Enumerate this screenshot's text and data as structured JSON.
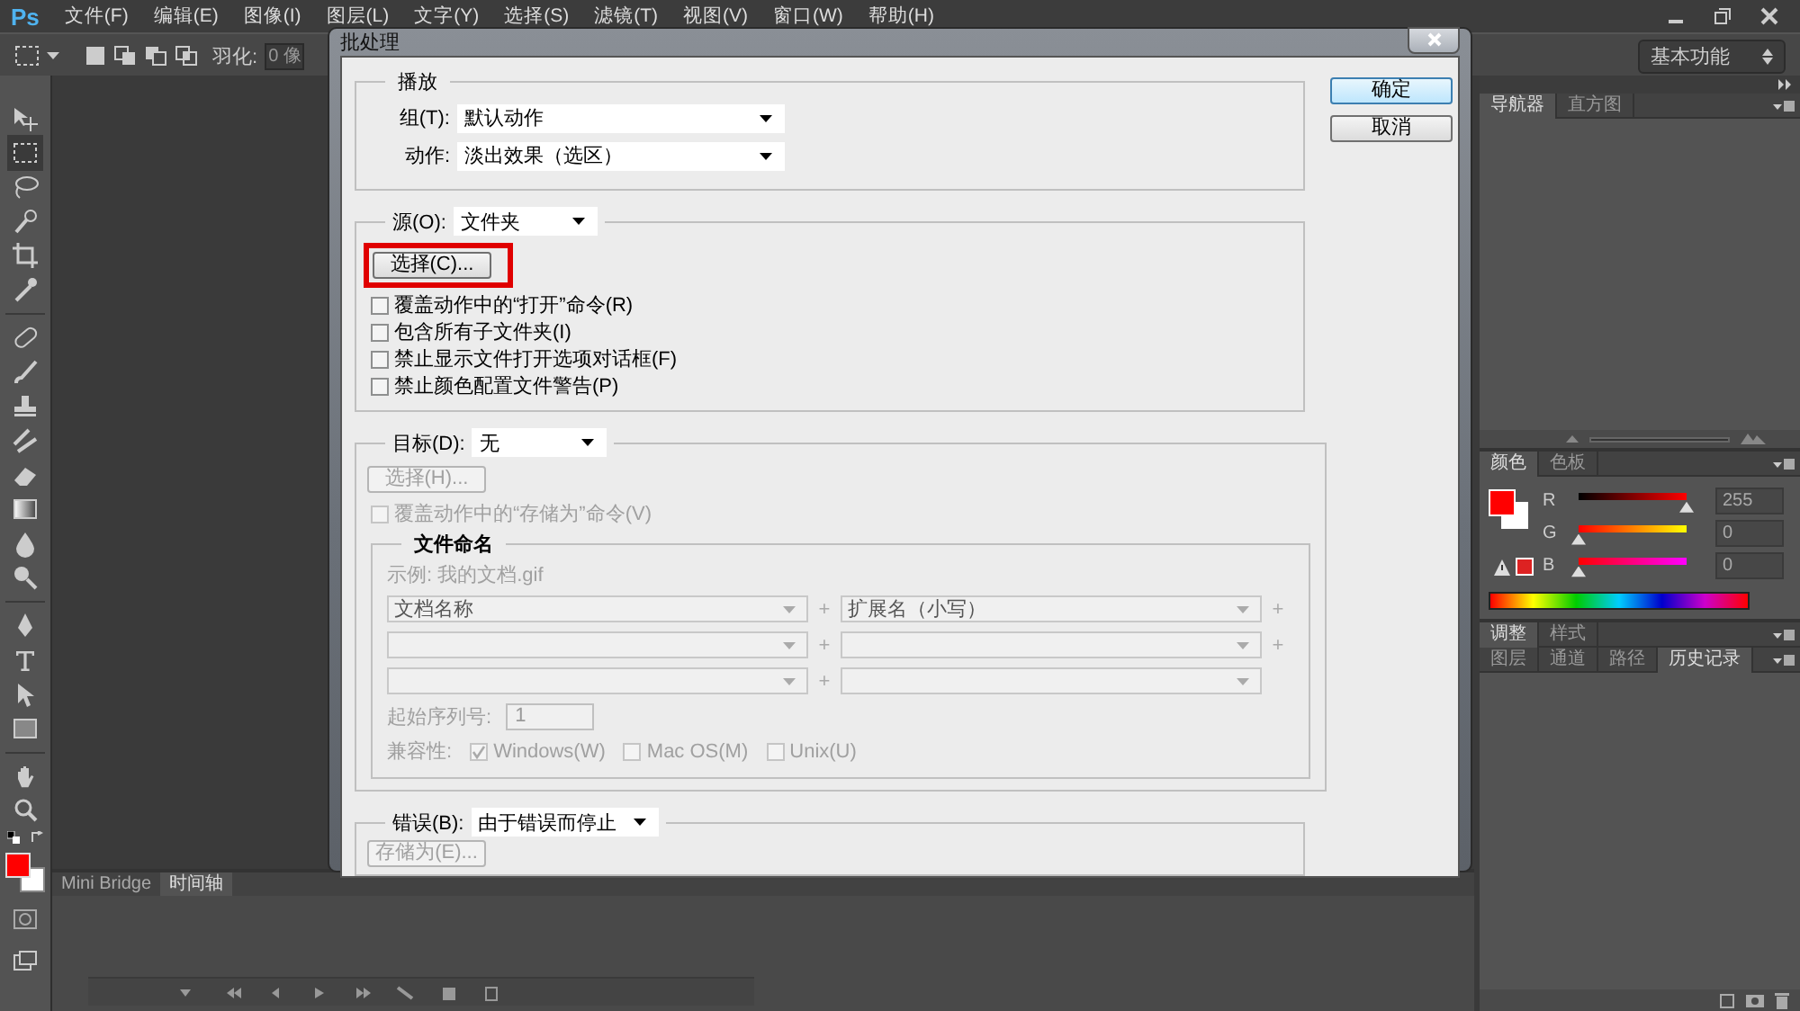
{
  "menu_bar": {
    "logo": "Ps",
    "items": [
      "文件(F)",
      "编辑(E)",
      "图像(I)",
      "图层(L)",
      "文字(Y)",
      "选择(S)",
      "滤镜(T)",
      "视图(V)",
      "窗口(W)",
      "帮助(H)"
    ]
  },
  "options_bar": {
    "feather_label": "羽化:",
    "feather_value": "0 像",
    "workspace": "基本功能"
  },
  "dialog": {
    "title": "批处理",
    "buttons": [
      {
        "label": "确定",
        "default": true
      },
      {
        "label": "取消",
        "default": false
      }
    ],
    "play": {
      "legend": "播放",
      "rows": [
        {
          "label": "组(T):",
          "value": "默认动作"
        },
        {
          "label": "动作:",
          "value": "淡出效果（选区）"
        }
      ]
    },
    "source": {
      "label": "源(O):",
      "value": "文件夹",
      "choose_button": {
        "label": "选择(C)...",
        "highlighted": true
      },
      "options": [
        {
          "label": "覆盖动作中的“打开”命令(R)",
          "checked": false
        },
        {
          "label": "包含所有子文件夹(I)",
          "checked": false
        },
        {
          "label": "禁止显示文件打开选项对话框(F)",
          "checked": false
        },
        {
          "label": "禁止颜色配置文件警告(P)",
          "checked": false
        }
      ]
    },
    "destination": {
      "label": "目标(D):",
      "value": "无",
      "choose_button": {
        "label": "选择(H)...",
        "disabled": true
      },
      "override": {
        "label": "覆盖动作中的“存储为”命令(V)",
        "checked": false,
        "disabled": true
      },
      "naming": {
        "legend": "文件命名",
        "disabled": true,
        "example": "示例: 我的文档.gif",
        "rows": [
          {
            "left": "文档名称",
            "joiner": "+",
            "right": "扩展名（小写）",
            "trailer": "+"
          },
          {
            "joiner": "+",
            "trailer": "+"
          },
          {
            "joiner": "+"
          }
        ],
        "serial_label": "起始序列号:",
        "serial_value": "1",
        "compat_label": "兼容性:",
        "compat": [
          {
            "label": "Windows(W)",
            "checked": true
          },
          {
            "label": "Mac OS(M)",
            "checked": false
          },
          {
            "label": "Unix(U)",
            "checked": false
          }
        ]
      }
    },
    "errors": {
      "label": "错误(B):",
      "value": "由于错误而停止",
      "save_button": {
        "label": "存储为(E)...",
        "disabled": true
      }
    }
  },
  "panels": {
    "navigator": {
      "tabs": [
        {
          "label": "导航器",
          "selected": true
        },
        {
          "label": "直方图",
          "selected": false
        }
      ]
    },
    "color": {
      "tabs": [
        {
          "label": "颜色",
          "selected": true
        },
        {
          "label": "色板",
          "selected": false
        }
      ],
      "channels": [
        {
          "name": "R",
          "level": 1,
          "value": "255"
        },
        {
          "name": "G",
          "level": 0,
          "value": "0"
        },
        {
          "name": "B",
          "level": 0,
          "value": "0"
        }
      ]
    },
    "adjustments": {
      "tabs": [
        {
          "label": "调整",
          "selected": true
        },
        {
          "label": "样式",
          "selected": false
        }
      ]
    },
    "layers": {
      "tabs": [
        {
          "label": "图层",
          "selected": false
        },
        {
          "label": "通道",
          "selected": false
        },
        {
          "label": "路径",
          "selected": false
        },
        {
          "label": "历史记录",
          "selected": true
        }
      ]
    }
  },
  "bottom_panel": {
    "tabs": [
      {
        "label": "Mini Bridge",
        "selected": false
      },
      {
        "label": "时间轴",
        "selected": true
      }
    ]
  }
}
